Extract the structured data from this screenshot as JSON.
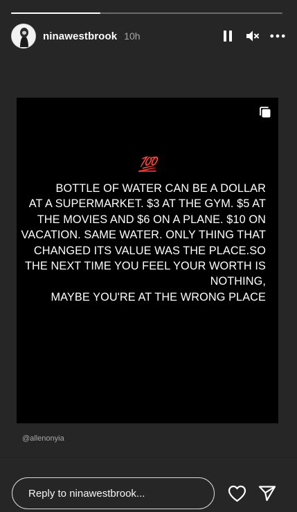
{
  "story": {
    "progress": 0.33,
    "username": "ninawestbrook",
    "time": "10h",
    "controls": {
      "pause_icon": "pause-icon",
      "mute_icon": "muted-speaker-icon",
      "more_icon": "more-options-icon"
    }
  },
  "post": {
    "carousel_icon": "carousel-icon",
    "emoji": "💯",
    "quote": "BOTTLE OF WATER CAN BE A DOLLAR\nAT A SUPERMARKET. $3 AT THE GYM. $5 AT\nTHE MOVIES AND $6 ON A PLANE. $10 ON\nVACATION. SAME WATER. ONLY THING THAT\nCHANGED ITS VALUE WAS THE PLACE.SO\nTHE NEXT TIME YOU FEEL YOUR WORTH IS\nNOTHING,\nMAYBE YOU'RE AT THE WRONG PLACE",
    "credit": "@allenonyia"
  },
  "reply": {
    "placeholder": "Reply to ninawestbrook...",
    "like_icon": "heart-icon",
    "share_icon": "send-icon"
  },
  "colors": {
    "background": "#262626",
    "post_background": "#000000",
    "accent_red": "#e0242b"
  }
}
